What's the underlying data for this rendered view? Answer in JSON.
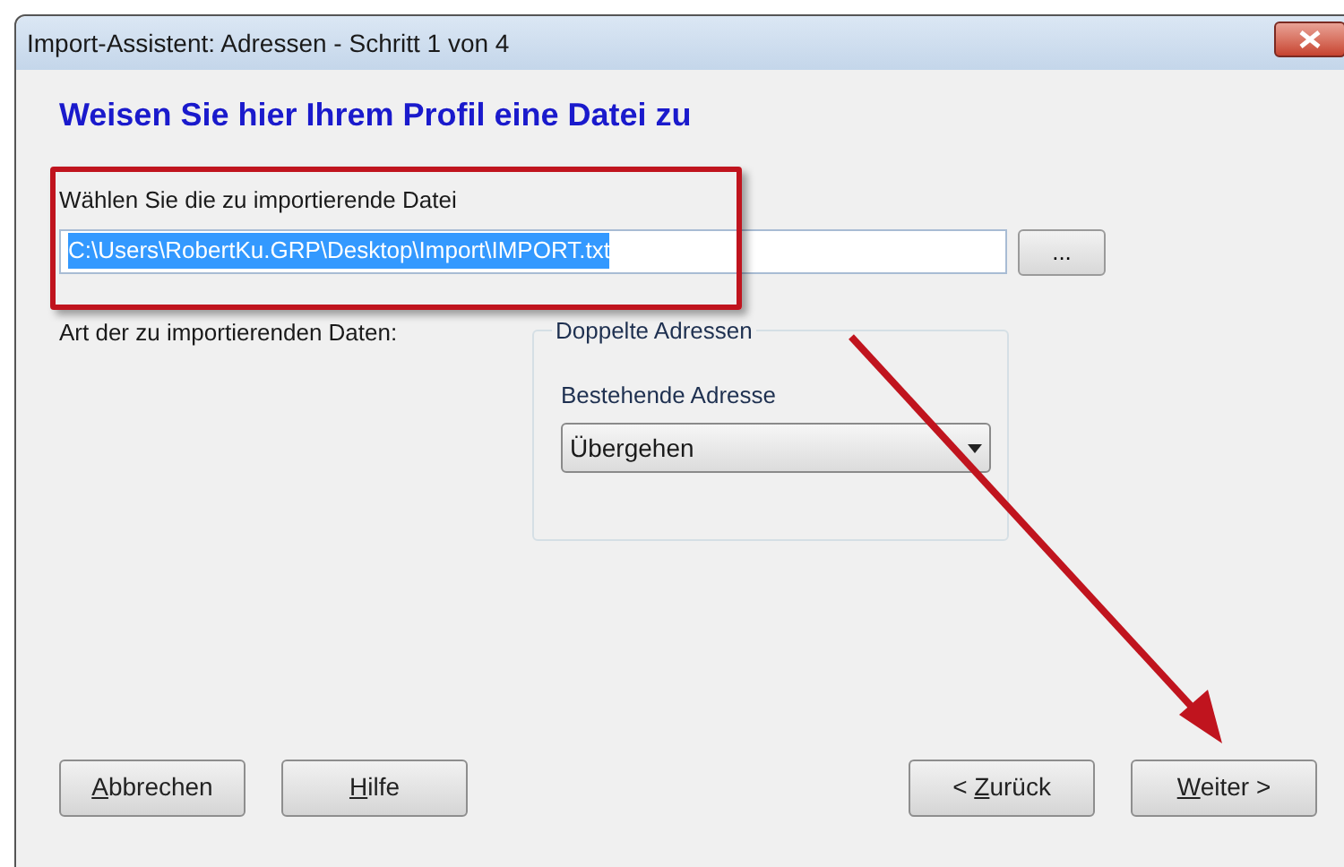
{
  "window": {
    "title": "Import-Assistent: Adressen - Schritt 1 von 4"
  },
  "heading": "Weisen Sie hier Ihrem Profil eine Datei zu",
  "file": {
    "label": "Wählen Sie die zu importierende Datei",
    "value": "C:\\Users\\RobertKu.GRP\\Desktop\\Import\\IMPORT.txt",
    "text_selected": true,
    "browse_button": "..."
  },
  "data_type_label": "Art der zu importierenden Daten:",
  "duplicates": {
    "legend": "Doppelte Adressen",
    "label": "Bestehende Adresse",
    "value": "Übergehen"
  },
  "left_buttons": [
    {
      "key": "A",
      "after": "bbrechen"
    },
    {
      "key": "H",
      "after": "ilfe"
    }
  ],
  "right_buttons": [
    {
      "before": "< ",
      "key": "Z",
      "after": "urück"
    },
    {
      "key": "W",
      "after": "eiter >"
    }
  ]
}
